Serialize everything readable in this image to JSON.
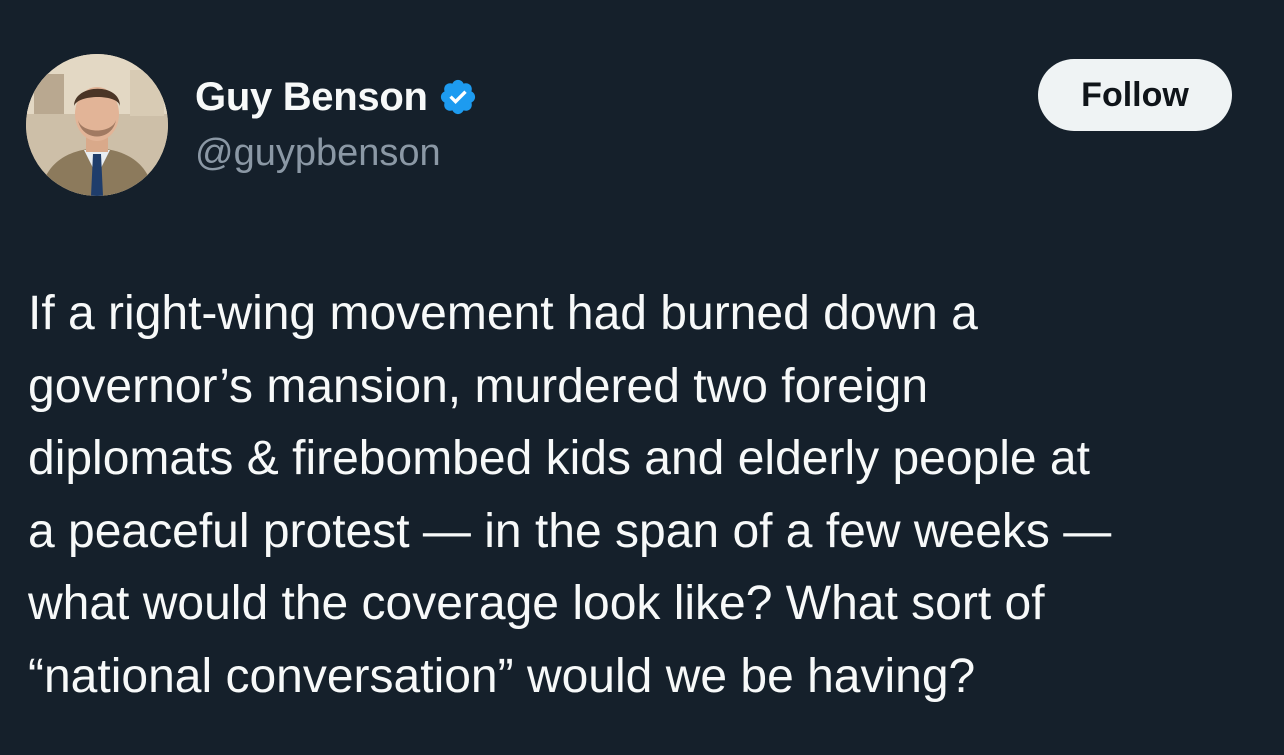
{
  "author": {
    "display_name": "Guy Benson",
    "handle": "@guypbenson",
    "verified": true,
    "avatar_icon": "profile-photo"
  },
  "follow_label": "Follow",
  "tweet": {
    "lines": [
      "If a right-wing movement had burned down a",
      "governor’s mansion, murdered two foreign",
      "diplomats & firebombed kids and elderly people at",
      "a peaceful protest — in the span of a few weeks —",
      "what would the coverage look like? What sort of",
      "“national conversation” would we be having?"
    ]
  },
  "colors": {
    "background": "#15202b",
    "text": "#f7f9f9",
    "secondary_text": "#8b98a5",
    "verified_badge": "#1d9bf0",
    "follow_button_bg": "#eff3f4",
    "follow_button_text": "#0f1419"
  }
}
